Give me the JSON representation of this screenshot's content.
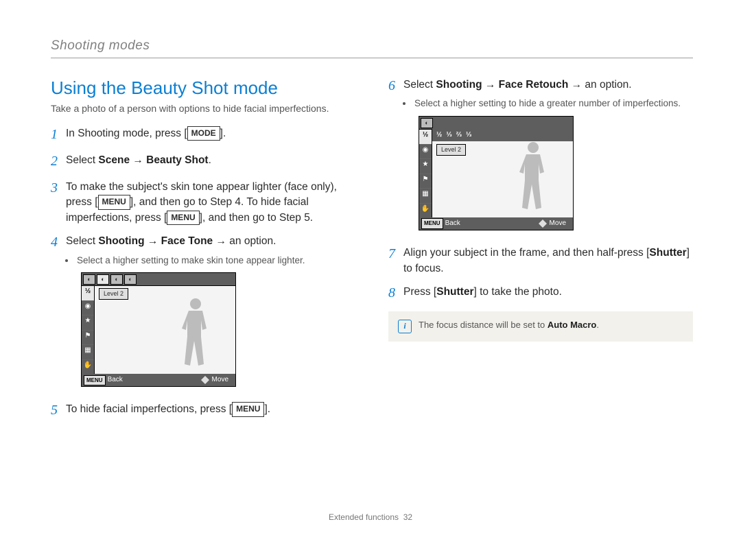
{
  "chapter": "Shooting modes",
  "section_title": "Using the Beauty Shot mode",
  "intro": "Take a photo of a person with options to hide facial imperfections.",
  "steps": {
    "s1": {
      "num": "1",
      "pre": "In Shooting mode, press [",
      "key": "MODE",
      "post": "]."
    },
    "s2": {
      "num": "2",
      "pre": "Select ",
      "b": "Scene → Beauty Shot",
      "post": "."
    },
    "s3": {
      "num": "3",
      "line1": "To make the subject's skin tone appear lighter (face only), press [",
      "key1": "MENU",
      "mid": "], and then go to Step 4. To hide facial imperfections, press [",
      "key2": "MENU",
      "post": "], and then go to Step 5."
    },
    "s4": {
      "num": "4",
      "pre": "Select ",
      "b": "Shooting → Face Tone",
      "post": " → an option.",
      "bullet": "Select a higher setting to make skin tone appear lighter."
    },
    "s5": {
      "num": "5",
      "pre": "To hide facial imperfections, press [",
      "key": "MENU",
      "post": "]."
    },
    "s6": {
      "num": "6",
      "pre": "Select ",
      "b": "Shooting → Face Retouch",
      "post": " → an option.",
      "bullet": "Select a higher setting to hide a greater number of imperfections."
    },
    "s7": {
      "num": "7",
      "pre": "Align your subject in the frame, and then half-press [",
      "b": "Shutter",
      "post": "] to focus."
    },
    "s8": {
      "num": "8",
      "pre": "Press [",
      "b": "Shutter",
      "post": "] to take the photo."
    }
  },
  "note": {
    "pre": "The focus distance will be set to ",
    "b": "Auto Macro",
    "post": "."
  },
  "lcd": {
    "level": "Level 2",
    "back": "Back",
    "move": "Move",
    "menu": "MENU",
    "top_fractions": {
      "a": "½",
      "b": "⅓",
      "c": "⅔",
      "d": "⅓"
    }
  },
  "footer": {
    "label": "Extended functions",
    "page": "32"
  }
}
